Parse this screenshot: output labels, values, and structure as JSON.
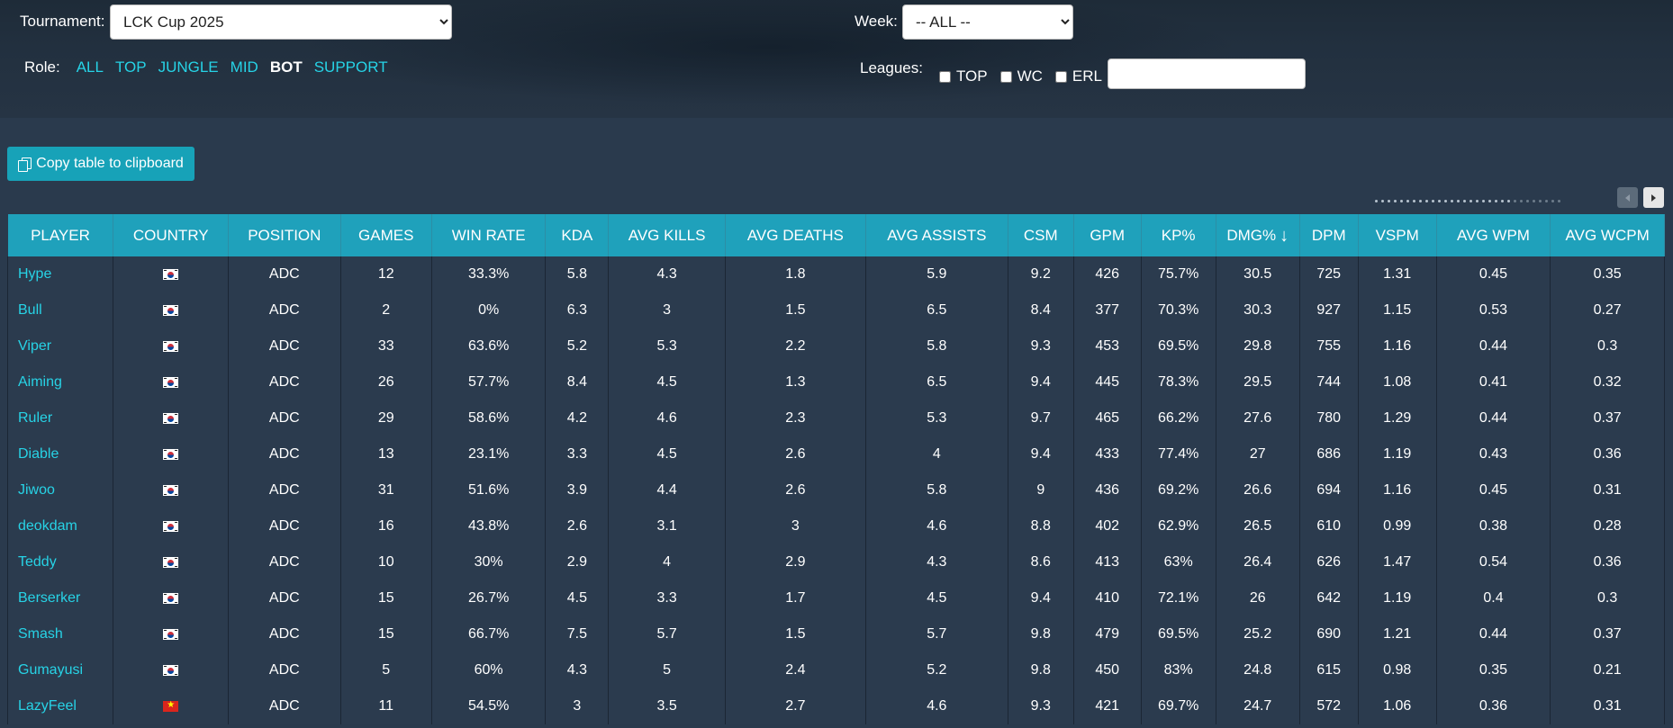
{
  "filters": {
    "tournament_label": "Tournament:",
    "tournament_value": "LCK Cup 2025",
    "week_label": "Week:",
    "week_value": "-- ALL --",
    "role_label": "Role:",
    "roles": [
      {
        "label": "ALL",
        "active": false
      },
      {
        "label": "TOP",
        "active": false
      },
      {
        "label": "JUNGLE",
        "active": false
      },
      {
        "label": "MID",
        "active": false
      },
      {
        "label": "BOT",
        "active": true
      },
      {
        "label": "SUPPORT",
        "active": false
      }
    ],
    "leagues_label": "Leagues:",
    "leagues": [
      {
        "label": "TOP",
        "checked": false
      },
      {
        "label": "WC",
        "checked": false
      },
      {
        "label": "ERL",
        "checked": false
      }
    ],
    "search_value": ""
  },
  "toolbar": {
    "copy_label": "Copy table to clipboard"
  },
  "table": {
    "columns": [
      "PLAYER",
      "COUNTRY",
      "POSITION",
      "GAMES",
      "WIN RATE",
      "KDA",
      "AVG KILLS",
      "AVG DEATHS",
      "AVG ASSISTS",
      "CSM",
      "GPM",
      "KP%",
      "DMG%",
      "DPM",
      "VSPM",
      "AVG WPM",
      "AVG WCPM"
    ],
    "sorted_column": "DMG%",
    "sort_direction": "descending",
    "rows": [
      [
        "Hype",
        "kr",
        "ADC",
        "12",
        "33.3%",
        "5.8",
        "4.3",
        "1.8",
        "5.9",
        "9.2",
        "426",
        "75.7%",
        "30.5",
        "725",
        "1.31",
        "0.45",
        "0.35"
      ],
      [
        "Bull",
        "kr",
        "ADC",
        "2",
        "0%",
        "6.3",
        "3",
        "1.5",
        "6.5",
        "8.4",
        "377",
        "70.3%",
        "30.3",
        "927",
        "1.15",
        "0.53",
        "0.27"
      ],
      [
        "Viper",
        "kr",
        "ADC",
        "33",
        "63.6%",
        "5.2",
        "5.3",
        "2.2",
        "5.8",
        "9.3",
        "453",
        "69.5%",
        "29.8",
        "755",
        "1.16",
        "0.44",
        "0.3"
      ],
      [
        "Aiming",
        "kr",
        "ADC",
        "26",
        "57.7%",
        "8.4",
        "4.5",
        "1.3",
        "6.5",
        "9.4",
        "445",
        "78.3%",
        "29.5",
        "744",
        "1.08",
        "0.41",
        "0.32"
      ],
      [
        "Ruler",
        "kr",
        "ADC",
        "29",
        "58.6%",
        "4.2",
        "4.6",
        "2.3",
        "5.3",
        "9.7",
        "465",
        "66.2%",
        "27.6",
        "780",
        "1.29",
        "0.44",
        "0.37"
      ],
      [
        "Diable",
        "kr",
        "ADC",
        "13",
        "23.1%",
        "3.3",
        "4.5",
        "2.6",
        "4",
        "9.4",
        "433",
        "77.4%",
        "27",
        "686",
        "1.19",
        "0.43",
        "0.36"
      ],
      [
        "Jiwoo",
        "kr",
        "ADC",
        "31",
        "51.6%",
        "3.9",
        "4.4",
        "2.6",
        "5.8",
        "9",
        "436",
        "69.2%",
        "26.6",
        "694",
        "1.16",
        "0.45",
        "0.31"
      ],
      [
        "deokdam",
        "kr",
        "ADC",
        "16",
        "43.8%",
        "2.6",
        "3.1",
        "3",
        "4.6",
        "8.8",
        "402",
        "62.9%",
        "26.5",
        "610",
        "0.99",
        "0.38",
        "0.28"
      ],
      [
        "Teddy",
        "kr",
        "ADC",
        "10",
        "30%",
        "2.9",
        "4",
        "2.9",
        "4.3",
        "8.6",
        "413",
        "63%",
        "26.4",
        "626",
        "1.47",
        "0.54",
        "0.36"
      ],
      [
        "Berserker",
        "kr",
        "ADC",
        "15",
        "26.7%",
        "4.5",
        "3.3",
        "1.7",
        "4.5",
        "9.4",
        "410",
        "72.1%",
        "26",
        "642",
        "1.19",
        "0.4",
        "0.3"
      ],
      [
        "Smash",
        "kr",
        "ADC",
        "15",
        "66.7%",
        "7.5",
        "5.7",
        "1.5",
        "5.7",
        "9.8",
        "479",
        "69.5%",
        "25.2",
        "690",
        "1.21",
        "0.44",
        "0.37"
      ],
      [
        "Gumayusi",
        "kr",
        "ADC",
        "5",
        "60%",
        "4.3",
        "5",
        "2.4",
        "5.2",
        "9.8",
        "450",
        "83%",
        "24.8",
        "615",
        "0.98",
        "0.35",
        "0.21"
      ],
      [
        "LazyFeel",
        "vn",
        "ADC",
        "11",
        "54.5%",
        "3",
        "3.5",
        "2.7",
        "4.6",
        "9.3",
        "421",
        "69.7%",
        "24.7",
        "572",
        "1.06",
        "0.36",
        "0.31"
      ]
    ]
  },
  "colors": {
    "header_bg": "#1fa1bb",
    "link": "#27d3e6",
    "page_bg": "#2a3a4d"
  }
}
